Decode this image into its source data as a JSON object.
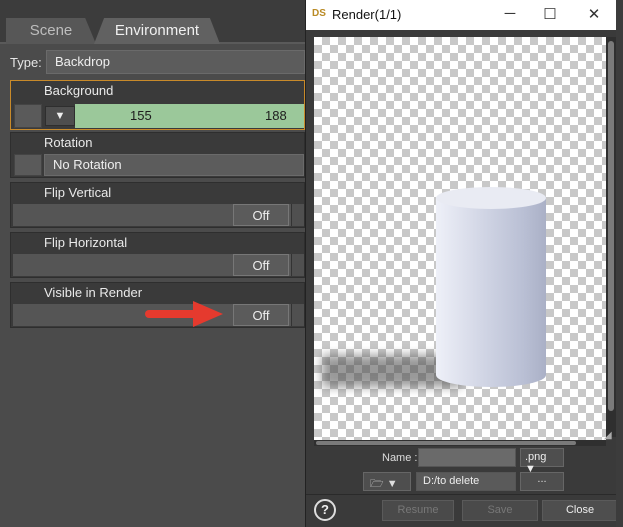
{
  "environment_pane": {
    "tabs": [
      {
        "label": "Scene"
      },
      {
        "label": "Environment"
      }
    ],
    "type_label": "Type:",
    "type_value": "Backdrop",
    "properties": [
      {
        "title": "Background",
        "value1": "155",
        "value2": "188"
      },
      {
        "title": "Rotation",
        "value": "No Rotation"
      },
      {
        "title": "Flip Vertical",
        "value": "Off"
      },
      {
        "title": "Flip Horizontal",
        "value": "Off"
      },
      {
        "title": "Visible in Render",
        "value": "Off"
      }
    ],
    "colors": {
      "highlight": "#c88a2a",
      "background_swatch": "#9bc89a",
      "annotation_arrow": "#e53a2e"
    }
  },
  "render_window": {
    "title": "Render(1/1)",
    "app_icon": "DS",
    "name_label": "Name :",
    "name_value": "",
    "extension": ".png ▼",
    "folder_arrow": "▼",
    "path": "D:/to delete",
    "browse_label": "...",
    "buttons": {
      "help": "?",
      "resume": "Resume",
      "save": "Save",
      "close": "Close"
    }
  }
}
